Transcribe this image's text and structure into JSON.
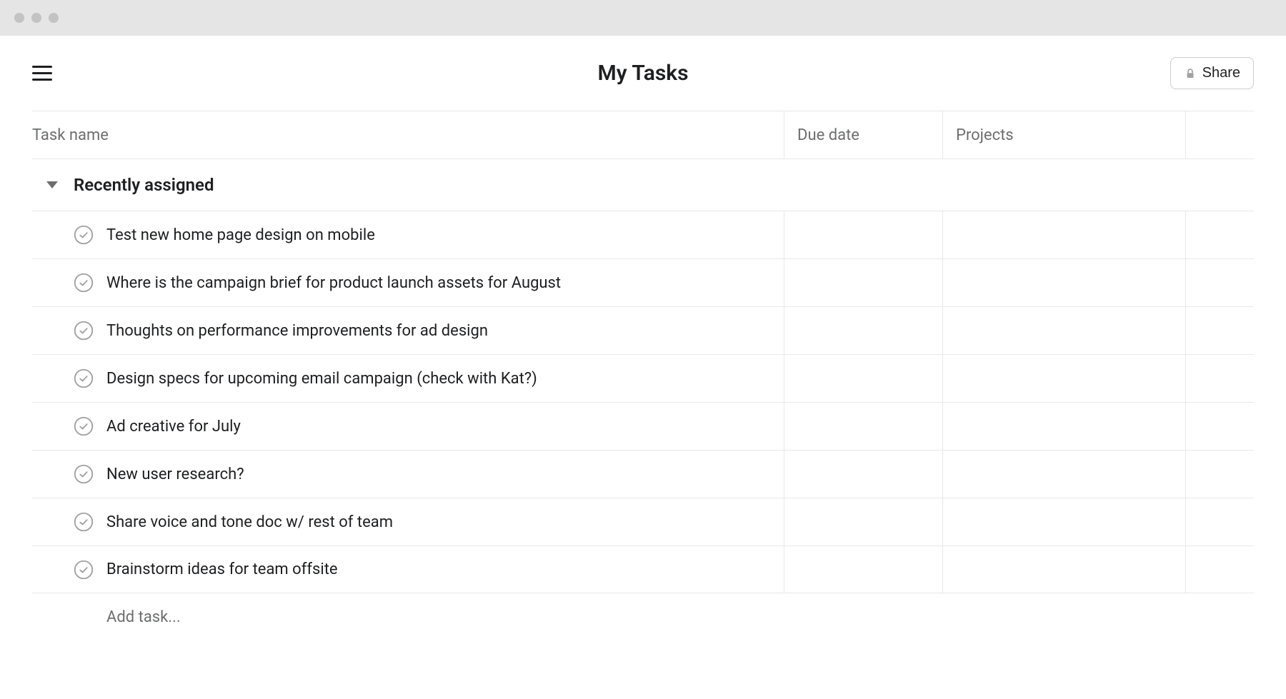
{
  "header": {
    "title": "My Tasks",
    "share_label": "Share"
  },
  "columns": {
    "task_name": "Task name",
    "due_date": "Due date",
    "projects": "Projects"
  },
  "section": {
    "title": "Recently assigned"
  },
  "tasks": [
    {
      "name": "Test new home page design on mobile"
    },
    {
      "name": "Where is the campaign brief for product launch assets for August"
    },
    {
      "name": "Thoughts on performance improvements for ad design"
    },
    {
      "name": "Design specs for upcoming email campaign (check with Kat?)"
    },
    {
      "name": "Ad creative for July"
    },
    {
      "name": "New user research?"
    },
    {
      "name": "Share voice and tone doc w/ rest of team"
    },
    {
      "name": "Brainstorm ideas for team offsite"
    }
  ],
  "add_task_placeholder": "Add task..."
}
